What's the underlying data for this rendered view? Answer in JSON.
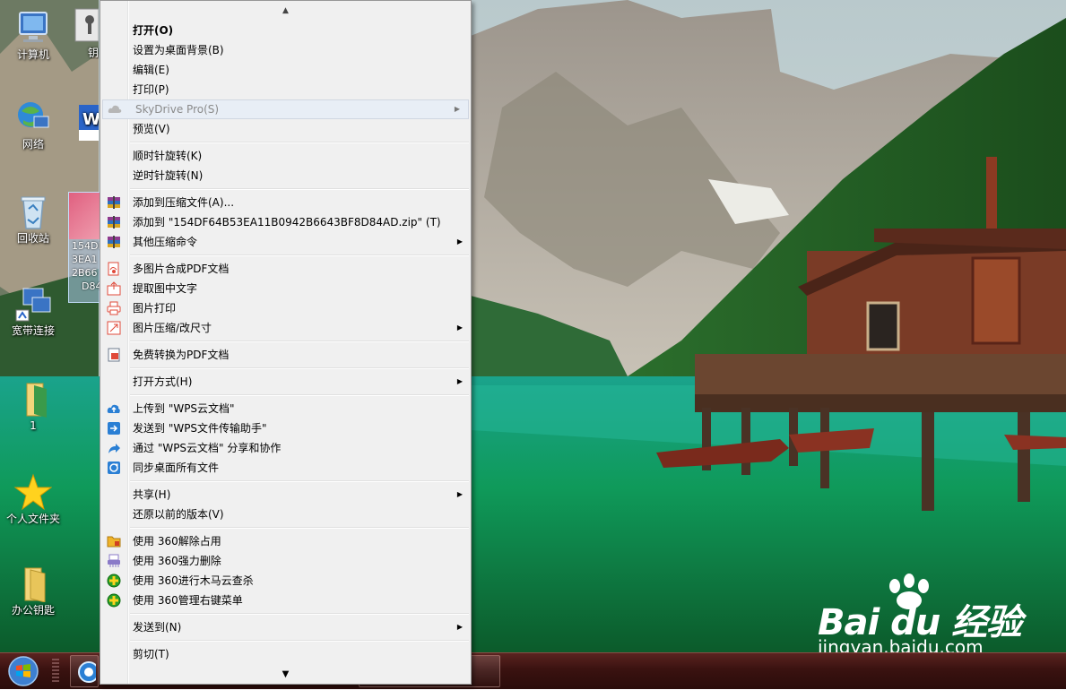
{
  "desktop": {
    "icons": [
      {
        "label": "计算机"
      },
      {
        "label": "钥"
      },
      {
        "label": "网络"
      },
      {
        "label": "回收站"
      },
      {
        "label": "宽带连接"
      },
      {
        "label": "1"
      },
      {
        "label": "个人文件夹"
      },
      {
        "label": "办公钥匙"
      }
    ],
    "selected_file_lines": [
      "154DI",
      "3EA1",
      "2B66",
      "D84"
    ]
  },
  "context_menu": {
    "items": [
      {
        "label": "打开(O)"
      },
      {
        "label": "设置为桌面背景(B)"
      },
      {
        "label": "编辑(E)"
      },
      {
        "label": "打印(P)"
      },
      {
        "label": "SkyDrive Pro(S)"
      },
      {
        "label": "预览(V)"
      },
      {
        "label": "顺时针旋转(K)"
      },
      {
        "label": "逆时针旋转(N)"
      },
      {
        "label": "添加到压缩文件(A)..."
      },
      {
        "label": "添加到 \"154DF64B53EA11B0942B6643BF8D84AD.zip\" (T)"
      },
      {
        "label": "其他压缩命令"
      },
      {
        "label": "多图片合成PDF文档"
      },
      {
        "label": "提取图中文字"
      },
      {
        "label": "图片打印"
      },
      {
        "label": "图片压缩/改尺寸"
      },
      {
        "label": "免费转换为PDF文档"
      },
      {
        "label": "打开方式(H)"
      },
      {
        "label": "上传到 \"WPS云文档\""
      },
      {
        "label": "发送到 \"WPS文件传输助手\""
      },
      {
        "label": "通过 \"WPS云文档\" 分享和协作"
      },
      {
        "label": "同步桌面所有文件"
      },
      {
        "label": "共享(H)"
      },
      {
        "label": "还原以前的版本(V)"
      },
      {
        "label": "使用 360解除占用"
      },
      {
        "label": "使用 360强力删除"
      },
      {
        "label": "使用 360进行木马云查杀"
      },
      {
        "label": "使用 360管理右键菜单"
      },
      {
        "label": "发送到(N)"
      },
      {
        "label": "剪切(T)"
      }
    ]
  },
  "watermark": {
    "logo_text": "Bai du 经验",
    "url": "jingyan.baidu.com"
  },
  "colors": {
    "menu_bg": "#f0f0f0",
    "taskbar": "#3a1210",
    "accent_blue": "#2a7fd4"
  },
  "icons": {
    "skydrive": "cloud-icon",
    "winrar": "archive-icon",
    "pdf": "pdf-icon",
    "wps_upload": "cloud-upload-icon",
    "360": "shield-icon"
  }
}
